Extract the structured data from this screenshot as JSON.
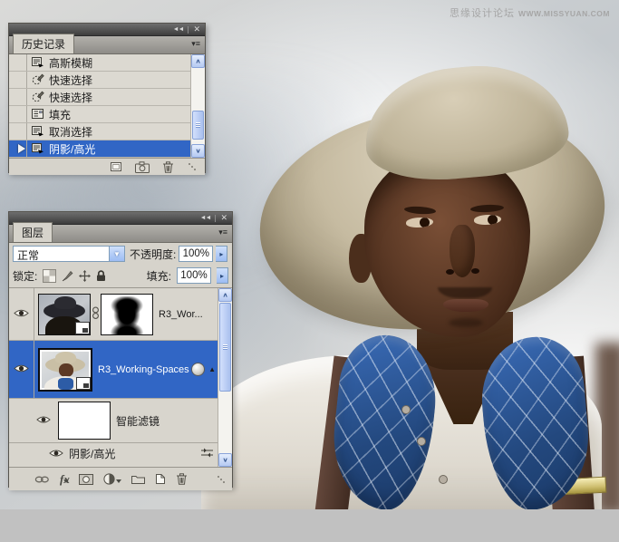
{
  "watermark": {
    "site_name": "思缘设计论坛",
    "url": "WWW.MISSYUAN.COM"
  },
  "icons": {
    "collapse": "◄◄",
    "close": "✕",
    "panel_menu": "▾≡",
    "combo_arrow": "▼",
    "spin_arrow": "▸",
    "scroll_up": "∧",
    "scroll_down": "∨",
    "expand_triangle": "▲",
    "fx": "fx"
  },
  "history_panel": {
    "title": "历史记录",
    "items": [
      {
        "label": "高斯模糊",
        "icon": "dialog-state-icon",
        "selected": false
      },
      {
        "label": "快速选择",
        "icon": "quick-select-icon",
        "selected": false
      },
      {
        "label": "快速选择",
        "icon": "quick-select-icon",
        "selected": false
      },
      {
        "label": "填充",
        "icon": "fill-dialog-icon",
        "selected": false
      },
      {
        "label": "取消选择",
        "icon": "dialog-state-icon",
        "selected": false
      },
      {
        "label": "阴影/高光",
        "icon": "dialog-state-icon",
        "selected": true
      }
    ],
    "buttons": [
      "new-document-from-state",
      "new-snapshot",
      "delete-state"
    ]
  },
  "layers_panel": {
    "title": "图层",
    "blend_mode": "正常",
    "opacity_label": "不透明度:",
    "opacity_value": "100%",
    "lock_label": "锁定:",
    "fill_label": "填充:",
    "fill_value": "100%",
    "layers": [
      {
        "name": "R3_Wor...",
        "type": "smart-object-with-mask",
        "visible": true,
        "selected": false
      },
      {
        "name": "R3_Working-Spaces",
        "type": "smart-object",
        "visible": true,
        "selected": true
      },
      {
        "name": "智能滤镜",
        "type": "smart-filters",
        "visible": true,
        "selected": false
      },
      {
        "name": "阴影/高光",
        "type": "smart-filter-item",
        "visible": true,
        "selected": false
      }
    ],
    "buttons": [
      "link-layers",
      "layer-style",
      "add-mask",
      "adjustment-layer",
      "new-group",
      "new-layer",
      "delete-layer"
    ]
  },
  "colors": {
    "selection_blue": "#3166c5",
    "panel_gray": "#d6d3cb",
    "titlebar_dark": "#3c3c3c",
    "pasteboard": "#c1c1c1",
    "scarf_blue": "#2d5ca6",
    "hat_cream": "#c6bba1"
  }
}
